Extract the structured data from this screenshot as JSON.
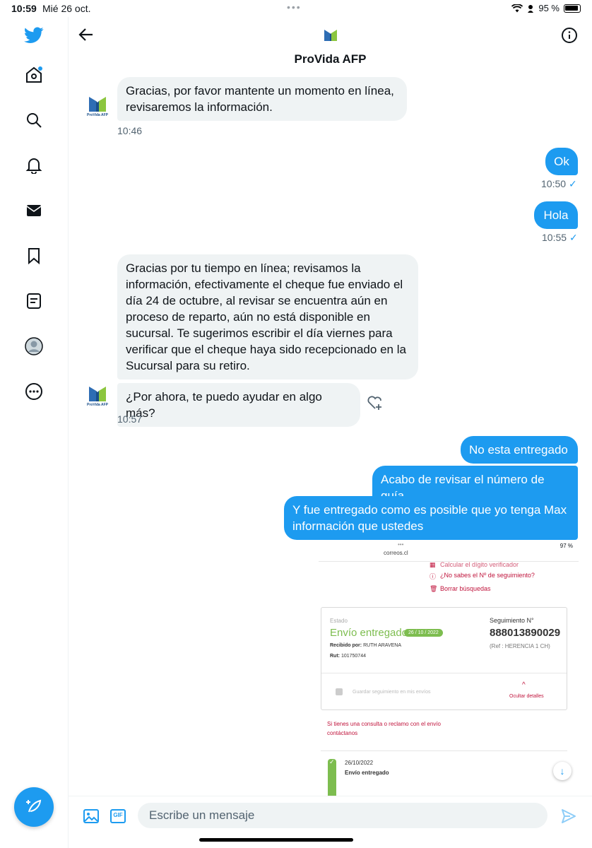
{
  "status_bar": {
    "time": "10:59",
    "date": "Mié 26 oct.",
    "battery": "95 %"
  },
  "header": {
    "title": "ProVida AFP"
  },
  "avatar_brand": "ProVida AFP",
  "messages": [
    {
      "dir": "in",
      "text": "Gracias, por favor mantente un momento en línea, revisaremos la información.",
      "time": "10:46"
    },
    {
      "dir": "out",
      "text": "Ok",
      "time": "10:50"
    },
    {
      "dir": "out",
      "text": "Hola",
      "time": "10:55"
    },
    {
      "dir": "in",
      "text": "Gracias por tu tiempo en línea; revisamos la información, efectivamente el cheque fue enviado el día 24 de octubre, al revisar se encuentra aún en proceso de reparto, aún no está disponible en sucursal. Te sugerimos escribir el día viernes para verificar que el cheque haya sido recepcionado en la Sucursal para su retiro."
    },
    {
      "dir": "in",
      "text": "¿Por ahora, te puedo ayudar en algo más?",
      "time": "10:57"
    },
    {
      "dir": "out",
      "text": "No esta entregado"
    },
    {
      "dir": "out",
      "text": "Acabo de revisar el número de guía"
    },
    {
      "dir": "out",
      "text": "Y fue entregado como es posible que yo tenga Max información que ustedes"
    }
  ],
  "attachment": {
    "battery": "97 %",
    "url": "correos.cl",
    "links": [
      "Calcular el dígito verificador",
      "¿No sabes el Nº de seguimiento?",
      "Borrar búsquedas"
    ],
    "estado_label": "Estado",
    "estado": "Envío entregado",
    "estado_fecha": "26 / 10 / 2022",
    "recibido_label": "Recibido por:",
    "recibido": "RUTH ARAVENA",
    "rut_label": "Rut:",
    "rut": "101750744",
    "seguimiento_label": "Seguimiento N°",
    "seguimiento": "888013890029",
    "ref": "(Ref : HERENCIA 1 CH)",
    "save_label": "Guardar seguimiento en mis envíos",
    "hide_label": "Ocultar detalles",
    "contact_text": "Si tienes una consulta o reclamo con el envío contáctanos",
    "track_date": "26/10/2022",
    "track_state": "Envío entregado"
  },
  "composer": {
    "placeholder": "Escribe un mensaje",
    "gif_label": "GIF"
  },
  "colors": {
    "accent": "#1d9bf0",
    "incoming_bubble": "#eff3f4",
    "delivered_green": "#7dbd4f",
    "correos_red": "#c0143c"
  }
}
